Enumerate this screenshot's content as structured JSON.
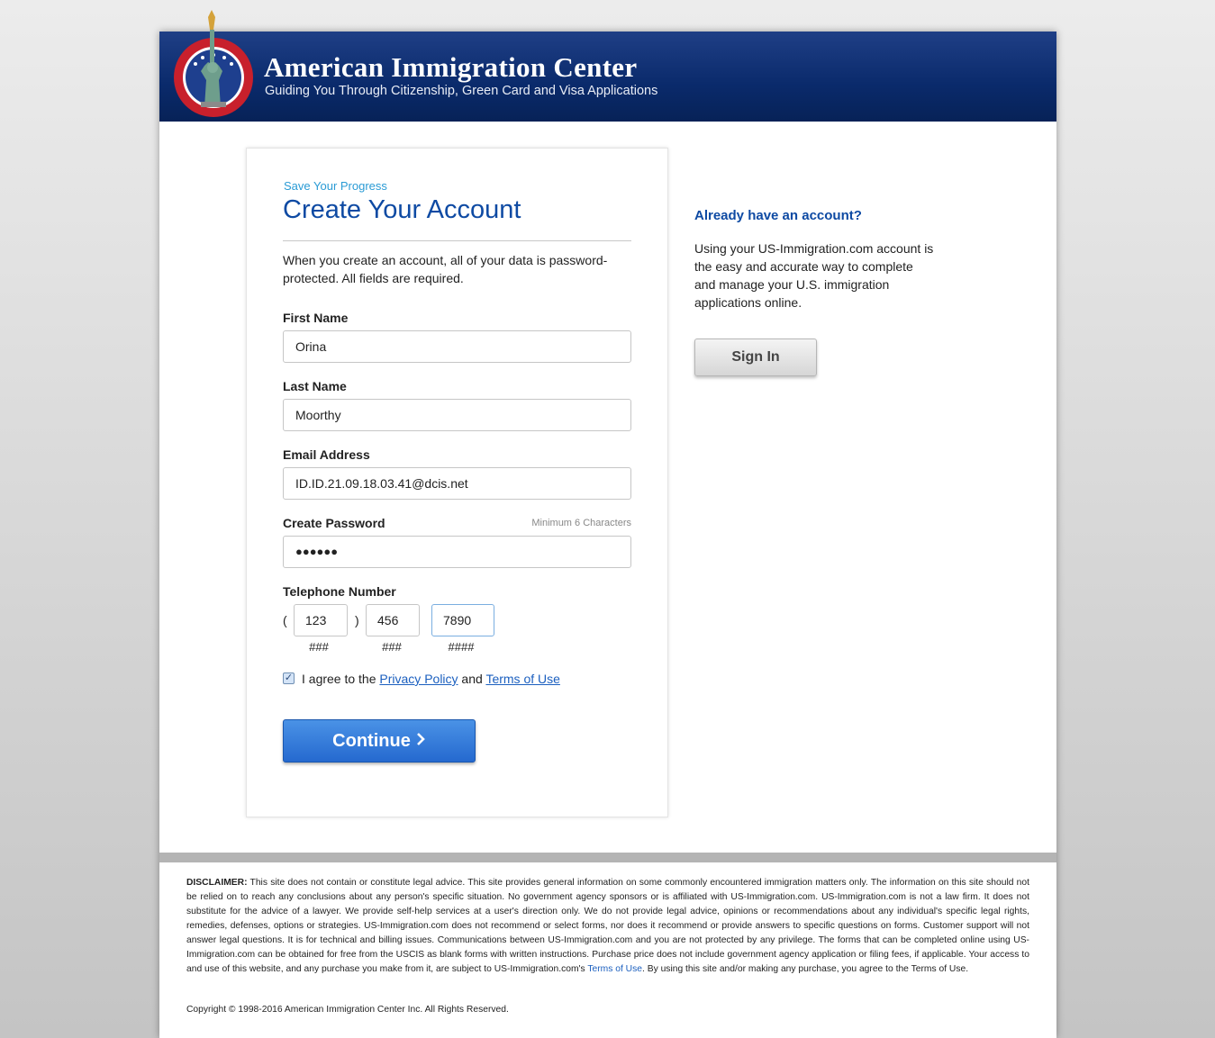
{
  "header": {
    "title": "American Immigration Center",
    "tagline": "Guiding You Through Citizenship, Green Card and Visa Applications",
    "logo_text": "AMERICAN IMMIGRATION CENTER",
    "brand_color": "#0a2a6b"
  },
  "form": {
    "eyebrow": "Save Your Progress",
    "title": "Create Your Account",
    "intro": "When you create an account, all of your data is password-protected. All fields are required.",
    "first_name": {
      "label": "First Name",
      "value": "Orina"
    },
    "last_name": {
      "label": "Last Name",
      "value": "Moorthy"
    },
    "email": {
      "label": "Email Address",
      "value": "ID.ID.21.09.18.03.41@dcis.net"
    },
    "password": {
      "label": "Create Password",
      "hint": "Minimum 6 Characters",
      "masked_value": "●●●●●●"
    },
    "phone": {
      "label": "Telephone Number",
      "open_paren": "(",
      "close_paren": ")",
      "area": "123",
      "prefix": "456",
      "line": "7890",
      "area_hint": "###",
      "prefix_hint": "###",
      "line_hint": "####"
    },
    "agree": {
      "checked": true,
      "check_mark": "✓",
      "prefix": "I agree to the ",
      "privacy_link": "Privacy Policy",
      "middle": " and ",
      "terms_link": "Terms of Use"
    },
    "continue_label": "Continue",
    "continue_icon": "›"
  },
  "sidebar": {
    "title": "Already have an account?",
    "text": "Using your US-Immigration.com account is the easy and accurate way to complete and manage your U.S. immigration applications online.",
    "signin_label": "Sign In"
  },
  "footer": {
    "disclaimer_label": "DISCLAIMER:",
    "disclaimer_text": " This site does not contain or constitute legal advice. This site provides general information on some commonly encountered immigration matters only. The information on this site should not be relied on to reach any conclusions about any person's specific situation. No government agency sponsors or is affiliated with US-Immigration.com. US-Immigration.com is not a law firm. It does not substitute for the advice of a lawyer. We provide self-help services at a user's direction only. We do not provide legal advice, opinions or recommendations about any individual's specific legal rights, remedies, defenses, options or strategies. US-Immigration.com does not recommend or select forms, nor does it recommend or provide answers to specific questions on forms. Customer support will not answer legal questions. It is for technical and billing issues. Communications between US-Immigration.com and you are not protected by any privilege. The forms that can be completed online using US-Immigration.com can be obtained for free from the USCIS as blank forms with written instructions. Purchase price does not include government agency application or filing fees, if applicable. Your access to and use of this website, and any purchase you make from it, are subject to US-Immigration.com's ",
    "terms_link": "Terms of Use",
    "disclaimer_tail": ". By using this site and/or making any purchase, you agree to the Terms of Use.",
    "copyright": "Copyright © 1998-2016 American Immigration Center Inc. All Rights Reserved."
  }
}
